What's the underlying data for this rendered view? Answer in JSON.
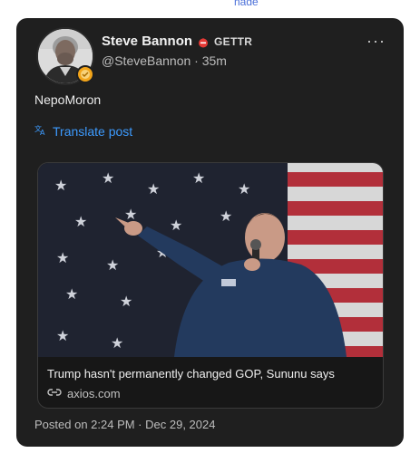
{
  "top_link_hint": "nage",
  "post": {
    "author": {
      "display_name": "Steve Bannon",
      "platform": "GETTR",
      "handle_time": "@SteveBannon · 35m"
    },
    "more_label": "···",
    "text": "NepoMoron",
    "translate_label": "Translate post",
    "link_preview": {
      "title": "Trump hasn't permanently changed GOP, Sununu says",
      "domain": "axios.com"
    },
    "posted_at": "Posted on 2:24 PM · Dec 29, 2024"
  },
  "colors": {
    "card_bg": "#1f1f1f",
    "accent_blue": "#3d9bff",
    "gettr_red": "#e53935",
    "badge_gold": "#f3a51a"
  },
  "icons": [
    "more-icon",
    "gettr-logo-icon",
    "translate-icon",
    "link-icon",
    "verified-badge-icon"
  ]
}
